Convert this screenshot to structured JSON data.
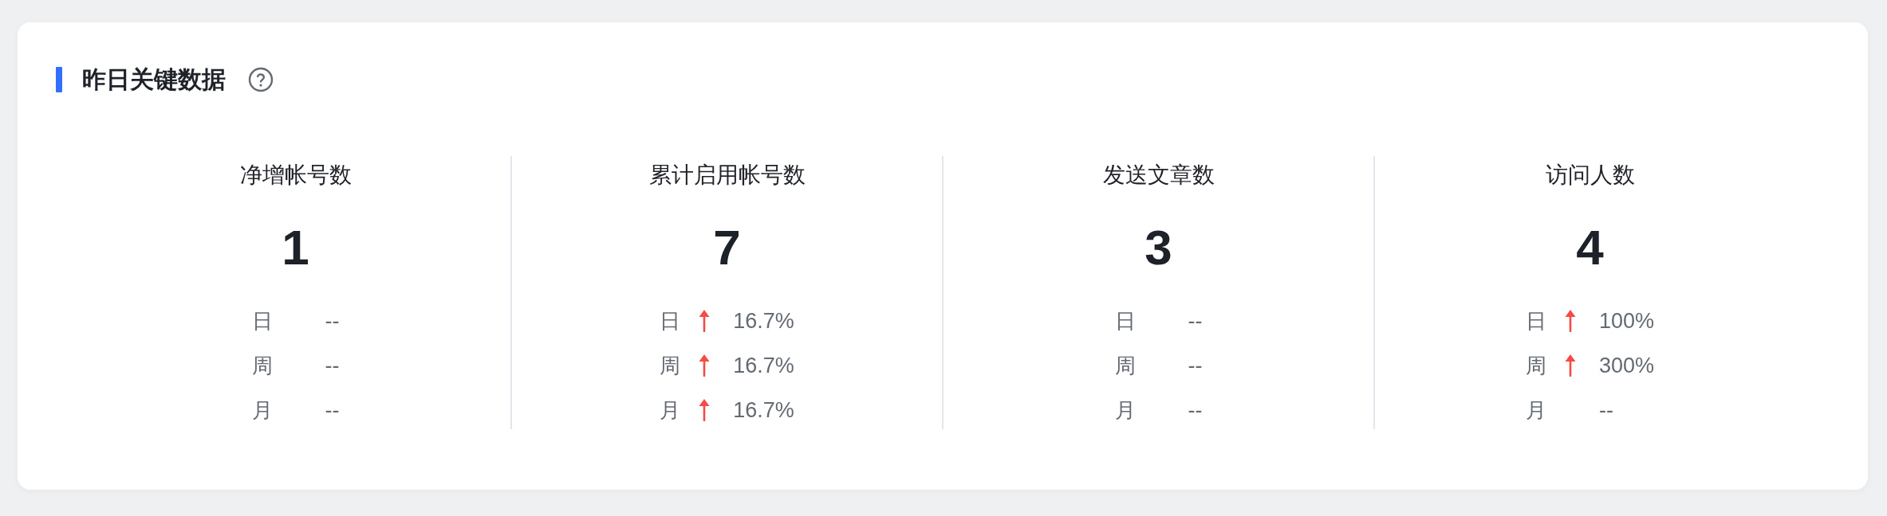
{
  "section": {
    "title": "昨日关键数据"
  },
  "metrics": [
    {
      "title": "净增帐号数",
      "value": "1",
      "changes": [
        {
          "period": "日",
          "up": false,
          "value": "--"
        },
        {
          "period": "周",
          "up": false,
          "value": "--"
        },
        {
          "period": "月",
          "up": false,
          "value": "--"
        }
      ]
    },
    {
      "title": "累计启用帐号数",
      "value": "7",
      "changes": [
        {
          "period": "日",
          "up": true,
          "value": "16.7%"
        },
        {
          "period": "周",
          "up": true,
          "value": "16.7%"
        },
        {
          "period": "月",
          "up": true,
          "value": "16.7%"
        }
      ]
    },
    {
      "title": "发送文章数",
      "value": "3",
      "changes": [
        {
          "period": "日",
          "up": false,
          "value": "--"
        },
        {
          "period": "周",
          "up": false,
          "value": "--"
        },
        {
          "period": "月",
          "up": false,
          "value": "--"
        }
      ]
    },
    {
      "title": "访问人数",
      "value": "4",
      "changes": [
        {
          "period": "日",
          "up": true,
          "value": "100%"
        },
        {
          "period": "周",
          "up": true,
          "value": "300%"
        },
        {
          "period": "月",
          "up": false,
          "value": "--"
        }
      ]
    }
  ]
}
